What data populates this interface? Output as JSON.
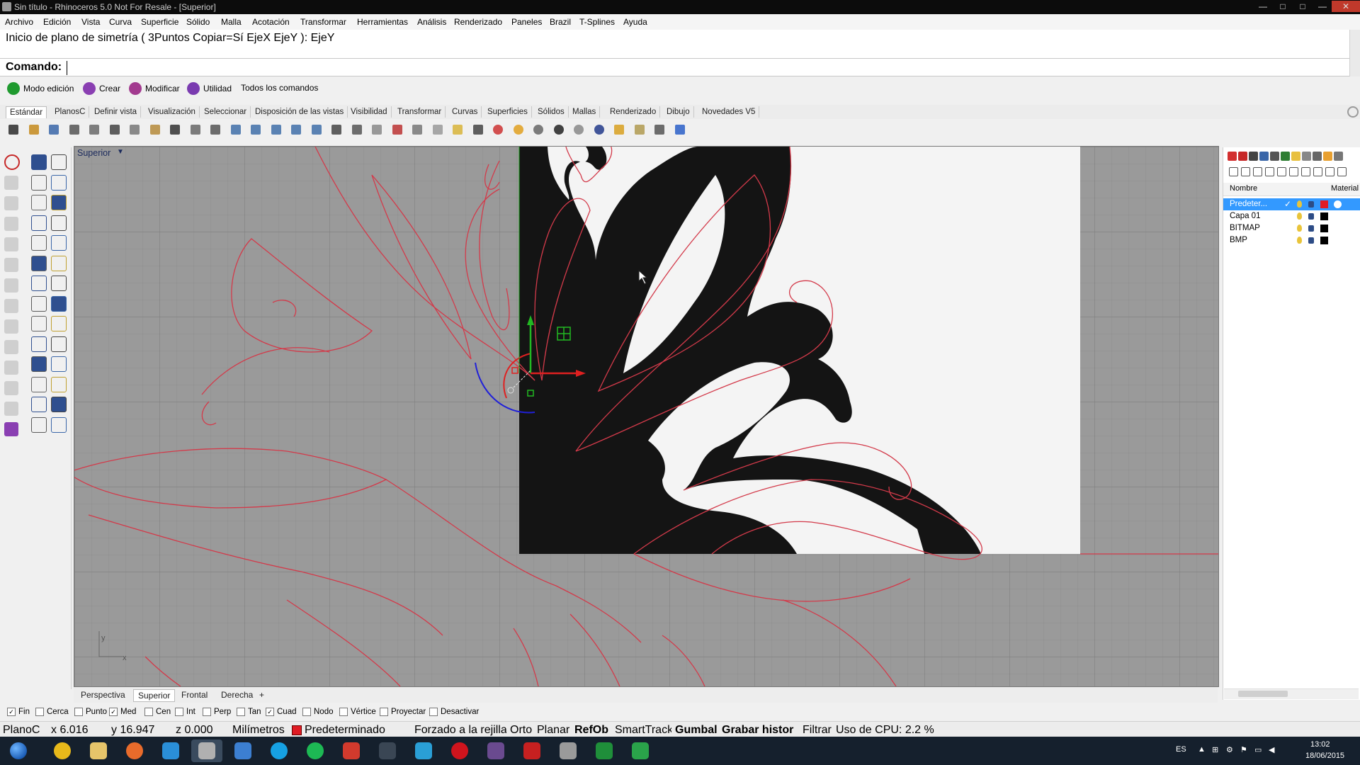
{
  "window": {
    "title": "Sin título - Rhinoceros 5.0 Not For Resale - [Superior]",
    "controls": [
      "—",
      "□",
      "✕"
    ]
  },
  "menu": [
    "Archivo",
    "Edición",
    "Vista",
    "Curva",
    "Superficie",
    "Sólido",
    "Malla",
    "Acotación",
    "Transformar",
    "Herramientas",
    "Análisis",
    "Renderizado",
    "Paneles",
    "Brazil",
    "T-Splines",
    "Ayuda"
  ],
  "command": {
    "history": "Inicio de plano de simetría ( 3Puntos  Copiar=Sí  EjeX  EjeY ): EjeY",
    "label": "Comando:",
    "value": ""
  },
  "modes": [
    {
      "label": "Modo edición",
      "color": "#1f9a2f"
    },
    {
      "label": "Crear",
      "color": "#8a3fb2"
    },
    {
      "label": "Modificar",
      "color": "#a23a8f"
    },
    {
      "label": "Utilidad",
      "color": "#7a3bb0"
    },
    {
      "label": "Todos los comandos",
      "color": ""
    }
  ],
  "toolbar_tabs": [
    "Estándar",
    "PlanosC",
    "Definir vista",
    "Visualización",
    "Seleccionar",
    "Disposición de las vistas",
    "Visibilidad",
    "Transformar",
    "Curvas",
    "Superficies",
    "Sólidos",
    "Mallas",
    "Renderizado",
    "Dibujo",
    "Novedades V5"
  ],
  "toolbar_icons": [
    "new-file",
    "open-folder",
    "save",
    "print",
    "import",
    "cut",
    "copy",
    "paste",
    "undo",
    "pan",
    "rotate-view",
    "zoom-in",
    "zoom-window",
    "zoom-extents",
    "zoom-selected",
    "zoom-dynamic",
    "four-viewports",
    "grid",
    "lighting",
    "set-cplane",
    "osnap",
    "properties",
    "light-bulb",
    "lock",
    "render-mesh",
    "color-wheel",
    "shaded",
    "rendered-ball",
    "ghosted-ball",
    "material-ball",
    "filter",
    "settings",
    "transform",
    "help"
  ],
  "left_tools": [
    "select-arrow",
    "point",
    "polyline",
    "curve-points",
    "circle",
    "arc",
    "triangle",
    "rectangle",
    "ellipse",
    "freeform",
    "surface",
    "extrude",
    "solid-box",
    "boolean",
    "mesh",
    "offset",
    "transform-move",
    "scale",
    "dimension",
    "text",
    "group",
    "block",
    "array",
    "explode",
    "analyze",
    "check",
    "render",
    "materials"
  ],
  "viewport": {
    "label": "Superior",
    "axis_x": "x",
    "axis_y": "y",
    "tabs": [
      "Perspectiva",
      "Superior",
      "Frontal",
      "Derecha",
      "+"
    ],
    "active_tab": "Superior"
  },
  "layers": {
    "header_name": "Nombre",
    "header_material": "Material",
    "rows": [
      {
        "name": "Predeter...",
        "check": "✓",
        "color": "#e01b24",
        "selected": true
      },
      {
        "name": "Capa 01",
        "check": "",
        "color": "#000000",
        "selected": false
      },
      {
        "name": "BITMAP",
        "check": "",
        "color": "#000000",
        "selected": false
      },
      {
        "name": "BMP",
        "check": "",
        "color": "#000000",
        "selected": false
      }
    ]
  },
  "osnaps": [
    {
      "label": "Fin",
      "checked": true
    },
    {
      "label": "Cerca",
      "checked": false
    },
    {
      "label": "Punto",
      "checked": false
    },
    {
      "label": "Med",
      "checked": true
    },
    {
      "label": "Cen",
      "checked": false
    },
    {
      "label": "Int",
      "checked": false
    },
    {
      "label": "Perp",
      "checked": false
    },
    {
      "label": "Tan",
      "checked": false
    },
    {
      "label": "Cuad",
      "checked": true
    },
    {
      "label": "Nodo",
      "checked": false
    },
    {
      "label": "Vértice",
      "checked": false
    },
    {
      "label": "Proyectar",
      "checked": false
    },
    {
      "label": "Desactivar",
      "checked": false
    }
  ],
  "status": {
    "cplane": "PlanoC",
    "x": "x 6.016",
    "y": "y 16.947",
    "z": "z 0.000",
    "units": "Milímetros",
    "layer": "Predeterminado",
    "layer_color": "#e01b24",
    "snap": "Forzado a la rejilla",
    "ortho": "Orto",
    "planar": "Planar",
    "refob": "RefOb",
    "smarttrack": "SmartTrack",
    "gumball": "Gumbal",
    "history": "Grabar histor",
    "filter": "Filtrar",
    "cpu": "Uso de CPU: 2.2 %"
  },
  "taskbar": {
    "apps": [
      {
        "name": "chrome",
        "color": "#e8b91a"
      },
      {
        "name": "explorer",
        "color": "#e6c46a"
      },
      {
        "name": "media-player",
        "color": "#e86b2b"
      },
      {
        "name": "internet-explorer",
        "color": "#2a8fd8"
      },
      {
        "name": "rhino",
        "color": "#b0b0b0"
      },
      {
        "name": "app-blue",
        "color": "#3c7fd1"
      },
      {
        "name": "skype",
        "color": "#16a1e3"
      },
      {
        "name": "spotify",
        "color": "#1db954"
      },
      {
        "name": "app-red",
        "color": "#d23a2d"
      },
      {
        "name": "rg-app",
        "color": "#3a4654"
      },
      {
        "name": "sketchup",
        "color": "#2a9fd6"
      },
      {
        "name": "opera",
        "color": "#d0141d"
      },
      {
        "name": "app-purple",
        "color": "#6a4a8f"
      },
      {
        "name": "acrobat",
        "color": "#c62020"
      },
      {
        "name": "app-gray",
        "color": "#9a9a9a"
      },
      {
        "name": "app-green",
        "color": "#1f8f3a"
      },
      {
        "name": "app-green2",
        "color": "#2aa34a"
      }
    ],
    "lang": "ES",
    "time": "13:02",
    "date": "18/06/2015"
  }
}
